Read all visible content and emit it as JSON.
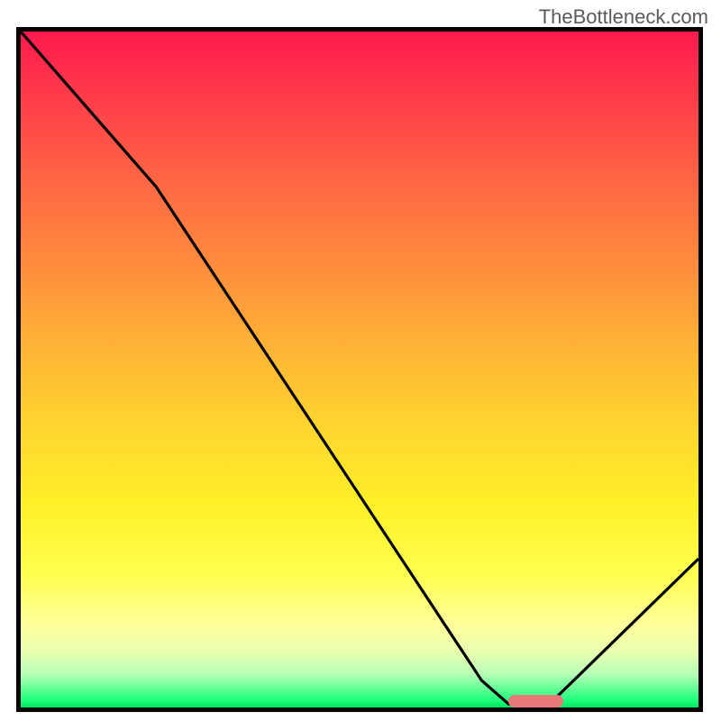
{
  "watermark": "TheBottleneck.com",
  "chart_data": {
    "type": "line",
    "title": "",
    "xlabel": "",
    "ylabel": "",
    "xlim": [
      0,
      100
    ],
    "ylim": [
      0,
      100
    ],
    "series": [
      {
        "name": "curve",
        "points": [
          {
            "x": 0,
            "y": 100
          },
          {
            "x": 20,
            "y": 77
          },
          {
            "x": 68,
            "y": 4
          },
          {
            "x": 72,
            "y": 0.5
          },
          {
            "x": 78,
            "y": 0.5
          },
          {
            "x": 100,
            "y": 22
          }
        ]
      }
    ],
    "marker": {
      "x_start": 72,
      "x_end": 80,
      "y": 1,
      "color": "#e87878"
    },
    "gradient_colors": {
      "top": "#ff1a4d",
      "mid": "#ffd42f",
      "bottom": "#00e65c"
    }
  }
}
